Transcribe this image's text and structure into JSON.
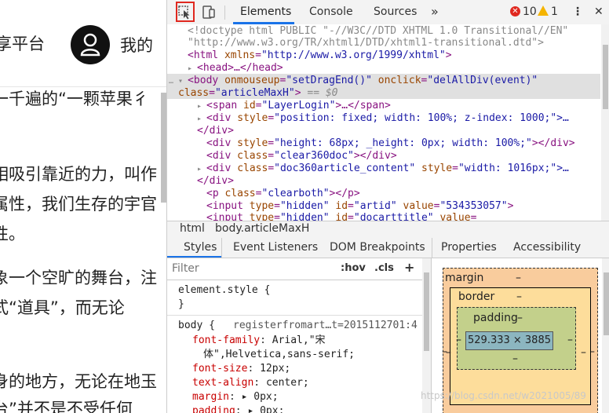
{
  "page": {
    "site_name": "享平台",
    "mine": "我的",
    "paragraphs": [
      "一千遍的“一颗苹果彳",
      "相吸引靠近的力，叫作",
      "属性，我们生存的宇官",
      "性。",
      "象一个空旷的舞台，注",
      "式“道具”，而无论",
      "身的地方，无论在地玉",
      "台”并不是不受任何"
    ]
  },
  "devtools": {
    "tabs": [
      "Elements",
      "Console",
      "Sources"
    ],
    "more_tabs": "»",
    "errors": "10",
    "warnings": "1",
    "menu": "⋮",
    "close": "✕"
  },
  "dom": {
    "doctype": "<!doctype html PUBLIC \"-//W3C//DTD XHTML 1.0 Transitional//EN\"",
    "doctype2": "\"http://www.w3.org/TR/xhtml1/DTD/xhtml1-transitional.dtd\">",
    "html_open_tag": "<html ",
    "html_attr": "xmlns",
    "html_val": "\"http://www.w3.org/1999/xhtml\"",
    "head": "<head>…</head>",
    "body_tag": "<body ",
    "body_a1": "onmouseup",
    "body_v1": "\"setDragEnd()\"",
    "body_a2": "onclick",
    "body_v2": "\"delAllDiv(event)\"",
    "body_a3": "class",
    "body_v3": "\"articleMaxH\"",
    "body_eq": "== $0",
    "span_tag": "<span ",
    "span_a": "id",
    "span_v": "\"LayerLogin\"",
    "span_end": ">…</span>",
    "div1_a": "style",
    "div1_v": "\"position: fixed; width: 100%; z-index: 1000;\">…",
    "div_close": "</div>",
    "div2_v": "\"height: 68px; _height: 0px; width: 100%;\"",
    "div2_end": "></div>",
    "div3_v": "\"clear360doc\"",
    "div4_v": "\"doc360article_content\"",
    "div4_a2": "style",
    "div4_v2": "\"width: 1016px;\">…",
    "p_v": "\"clearboth\"",
    "p_end": "></p>",
    "in1_v1": "\"hidden\"",
    "in1_v2": "\"artid\"",
    "in1_v3": "\"534353057\"",
    "in2_v1": "\"hidden\"",
    "in2_v2": "\"docarttitle\""
  },
  "breadcrumbs": [
    "html",
    "body.articleMaxH"
  ],
  "style_tabs": [
    "Styles",
    "Event Listeners",
    "DOM Breakpoints",
    "Properties",
    "Accessibility"
  ],
  "styles": {
    "filter_placeholder": "Filter",
    "hov": ":hov",
    "cls": ".cls",
    "add": "+",
    "element_style": "element.style {",
    "close_brace": "}",
    "body_selector": "body {",
    "source": "registerfromart…t=2015112701:4",
    "props": [
      {
        "name": "font-family",
        "value": "Arial,\"宋"
      },
      {
        "name": "",
        "value": "体\",Helvetica,sans-serif;"
      },
      {
        "name": "font-size",
        "value": "12px;"
      },
      {
        "name": "text-align",
        "value": "center;"
      },
      {
        "name": "margin",
        "value": "▸ 0px;"
      },
      {
        "name": "padding",
        "value": "▸ 0px;"
      }
    ]
  },
  "box_model": {
    "margin_label": "margin",
    "border_label": "border",
    "padding_label": "padding",
    "dash": "–",
    "content": "529.333 × 3885"
  },
  "watermark": "https://blog.csdn.net/w2021005/89"
}
